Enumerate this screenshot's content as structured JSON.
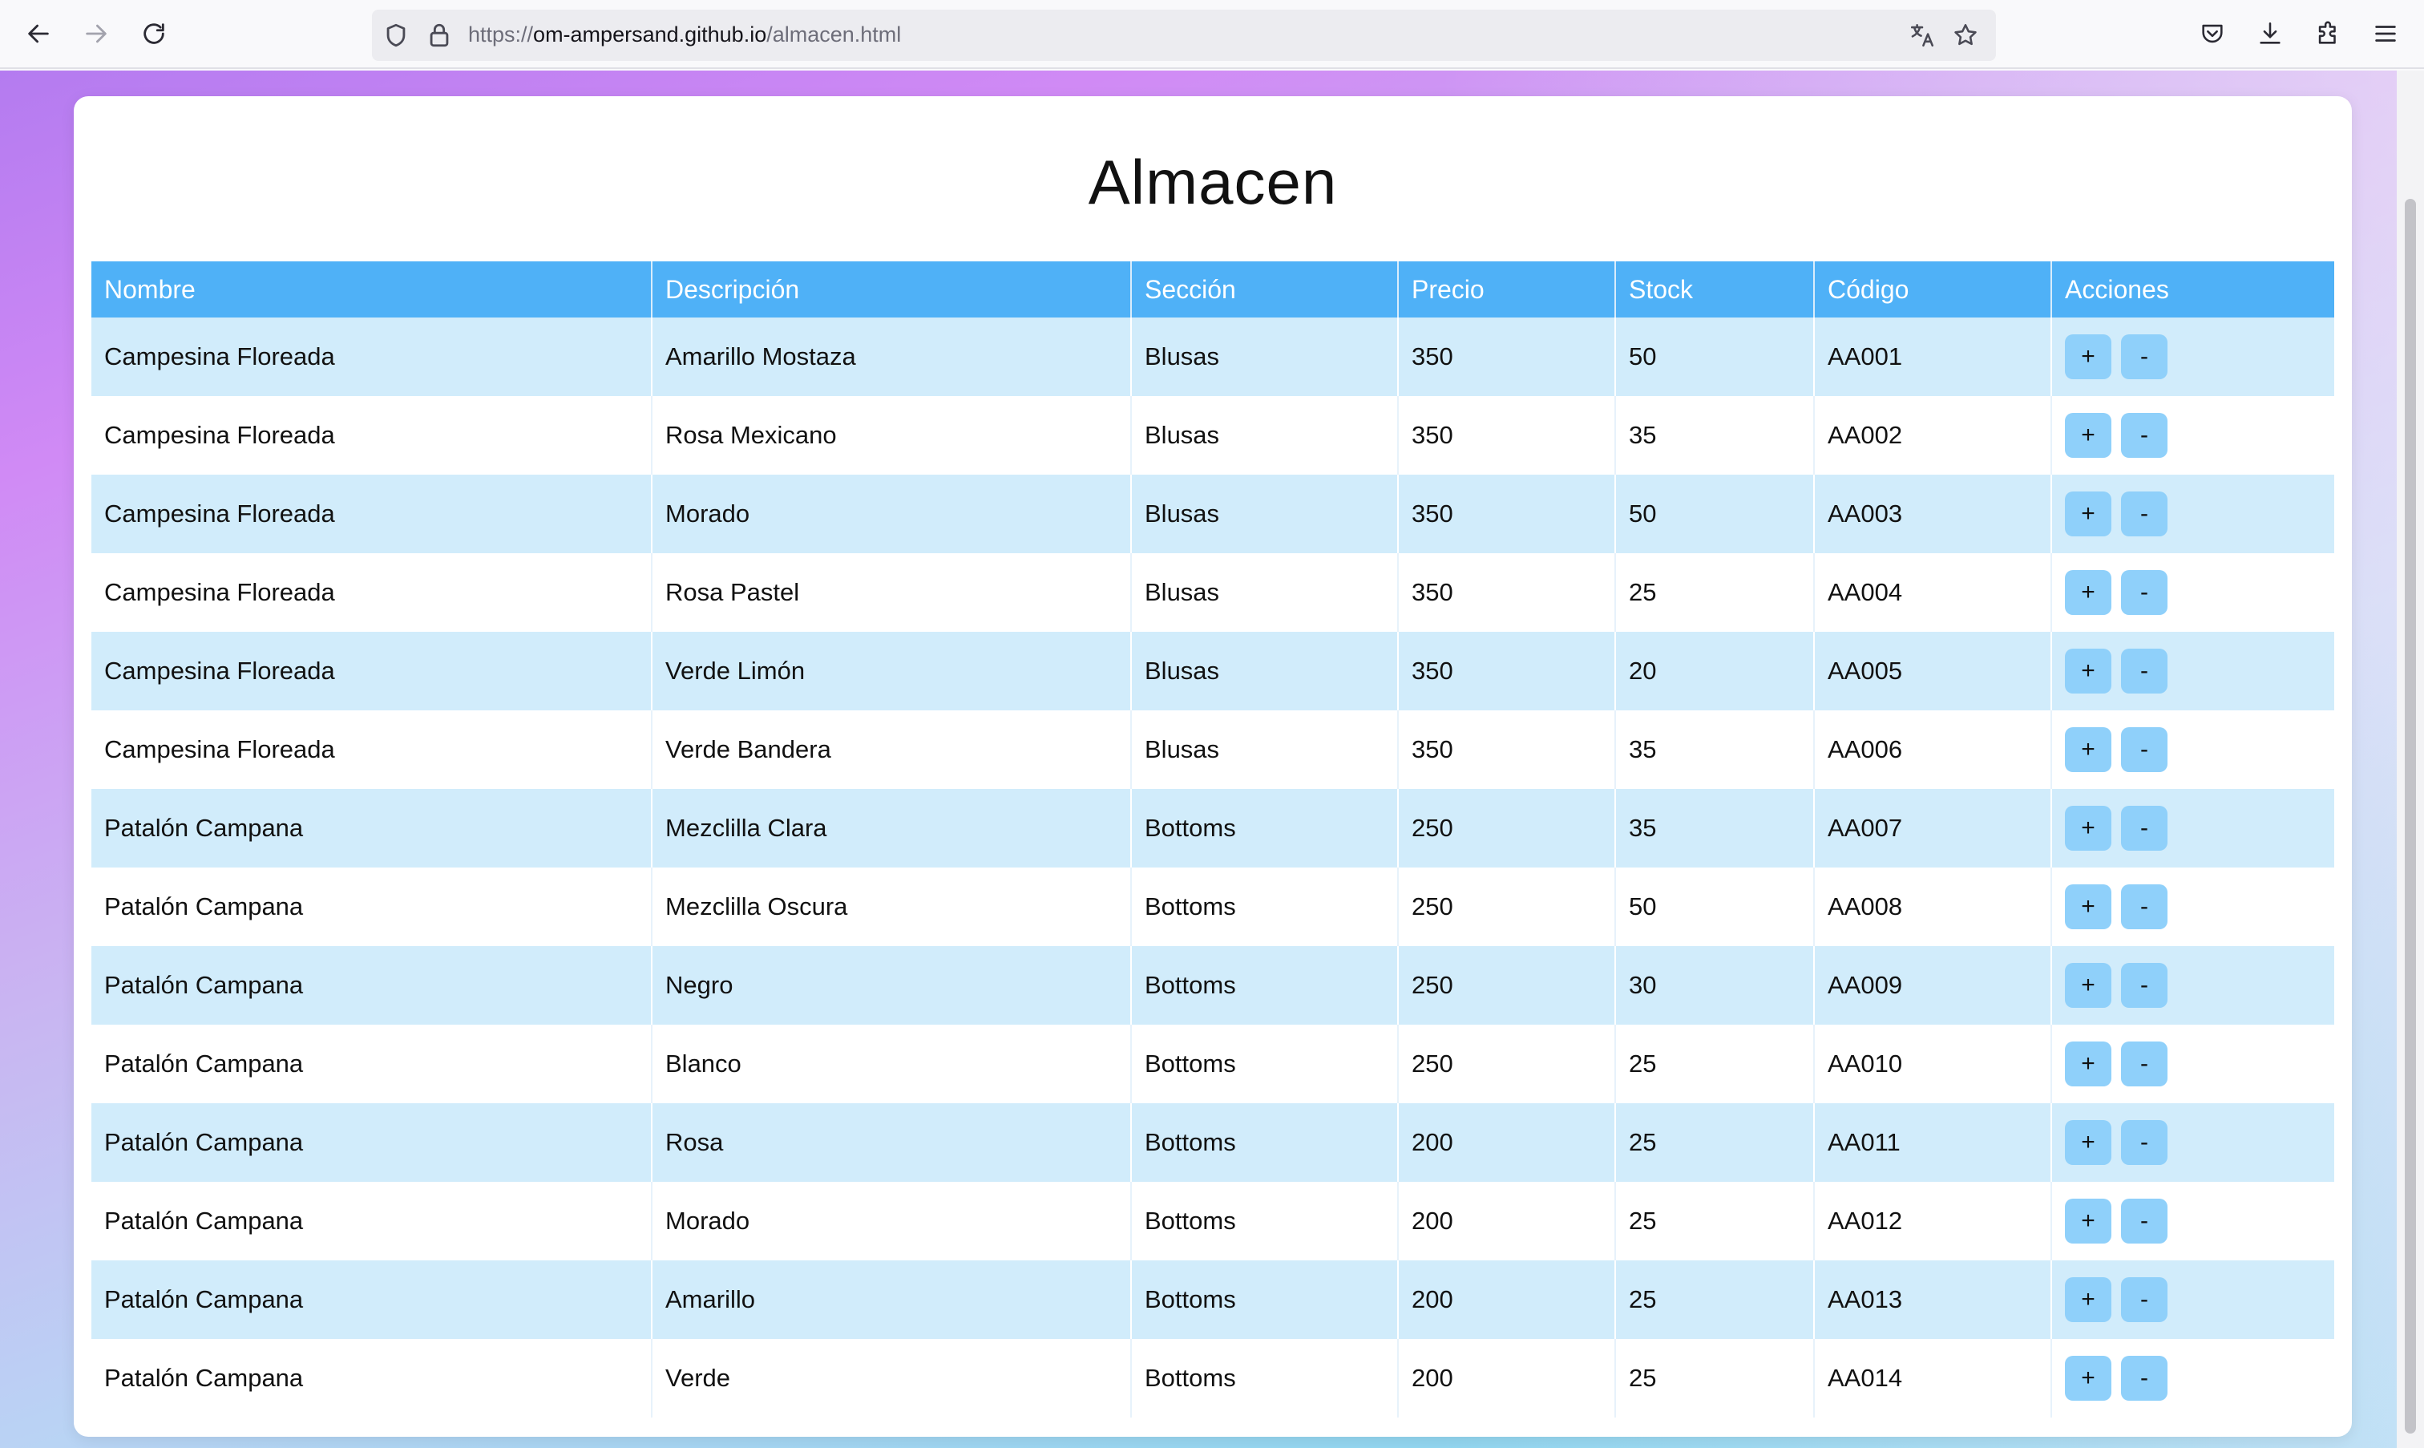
{
  "browser": {
    "url_prefix": "https://",
    "url_host": "om-ampersand.github.io",
    "url_path": "/almacen.html"
  },
  "page": {
    "title": "Almacen"
  },
  "table": {
    "headers": [
      "Nombre",
      "Descripción",
      "Sección",
      "Precio",
      "Stock",
      "Código",
      "Acciones"
    ],
    "rows": [
      [
        "Campesina Floreada",
        "Amarillo Mostaza",
        "Blusas",
        "350",
        "50",
        "AA001"
      ],
      [
        "Campesina Floreada",
        "Rosa Mexicano",
        "Blusas",
        "350",
        "35",
        "AA002"
      ],
      [
        "Campesina Floreada",
        "Morado",
        "Blusas",
        "350",
        "50",
        "AA003"
      ],
      [
        "Campesina Floreada",
        "Rosa Pastel",
        "Blusas",
        "350",
        "25",
        "AA004"
      ],
      [
        "Campesina Floreada",
        "Verde Limón",
        "Blusas",
        "350",
        "20",
        "AA005"
      ],
      [
        "Campesina Floreada",
        "Verde Bandera",
        "Blusas",
        "350",
        "35",
        "AA006"
      ],
      [
        "Patalón Campana",
        "Mezclilla Clara",
        "Bottoms",
        "250",
        "35",
        "AA007"
      ],
      [
        "Patalón Campana",
        "Mezclilla Oscura",
        "Bottoms",
        "250",
        "50",
        "AA008"
      ],
      [
        "Patalón Campana",
        "Negro",
        "Bottoms",
        "250",
        "30",
        "AA009"
      ],
      [
        "Patalón Campana",
        "Blanco",
        "Bottoms",
        "250",
        "25",
        "AA010"
      ],
      [
        "Patalón Campana",
        "Rosa",
        "Bottoms",
        "200",
        "25",
        "AA011"
      ],
      [
        "Patalón Campana",
        "Morado",
        "Bottoms",
        "200",
        "25",
        "AA012"
      ],
      [
        "Patalón Campana",
        "Amarillo",
        "Bottoms",
        "200",
        "25",
        "AA013"
      ],
      [
        "Patalón Campana",
        "Verde",
        "Bottoms",
        "200",
        "25",
        "AA014"
      ]
    ],
    "action_plus": "+",
    "action_minus": "-"
  },
  "colors": {
    "header_bg": "#4fb1f7",
    "row_alt_bg": "#d1ecfb",
    "button_bg": "#8fd0fa"
  }
}
